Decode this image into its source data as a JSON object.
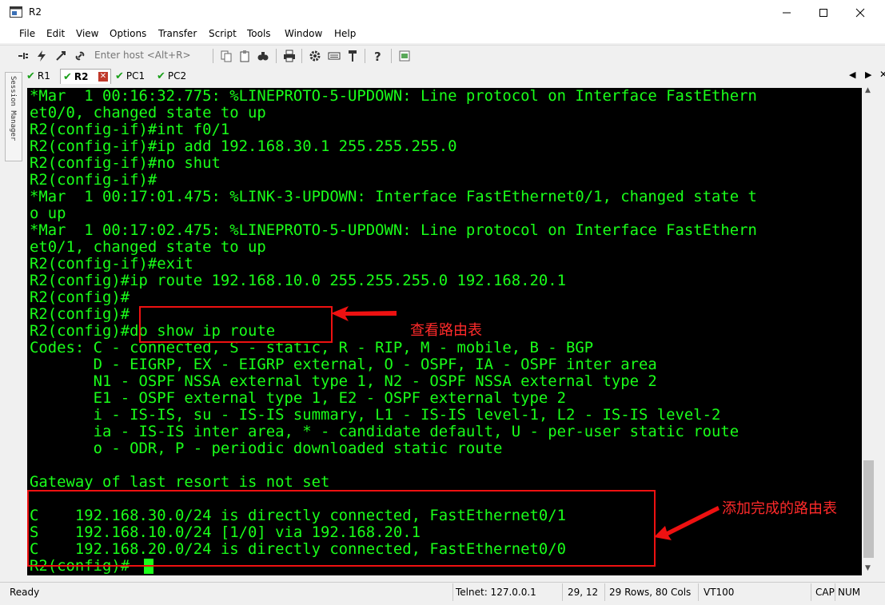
{
  "window": {
    "title": "R2"
  },
  "menu": [
    "File",
    "Edit",
    "View",
    "Options",
    "Transfer",
    "Script",
    "Tools",
    "Window",
    "Help"
  ],
  "toolbar": {
    "host_placeholder": "Enter host <Alt+R>"
  },
  "tabs": [
    {
      "label": "R1",
      "active": false
    },
    {
      "label": "R2",
      "active": true
    },
    {
      "label": "PC1",
      "active": false
    },
    {
      "label": "PC2",
      "active": false
    }
  ],
  "session_manager_label": "Session Manager",
  "terminal": {
    "lines": [
      "*Mar  1 00:16:32.775: %LINEPROTO-5-UPDOWN: Line protocol on Interface FastEthern",
      "et0/0, changed state to up",
      "R2(config-if)#int f0/1",
      "R2(config-if)#ip add 192.168.30.1 255.255.255.0",
      "R2(config-if)#no shut",
      "R2(config-if)#",
      "*Mar  1 00:17:01.475: %LINK-3-UPDOWN: Interface FastEthernet0/1, changed state t",
      "o up",
      "*Mar  1 00:17:02.475: %LINEPROTO-5-UPDOWN: Line protocol on Interface FastEthern",
      "et0/1, changed state to up",
      "R2(config-if)#exit",
      "R2(config)#ip route 192.168.10.0 255.255.255.0 192.168.20.1",
      "R2(config)#",
      "R2(config)#",
      "R2(config)#do show ip route",
      "Codes: C - connected, S - static, R - RIP, M - mobile, B - BGP",
      "       D - EIGRP, EX - EIGRP external, O - OSPF, IA - OSPF inter area",
      "       N1 - OSPF NSSA external type 1, N2 - OSPF NSSA external type 2",
      "       E1 - OSPF external type 1, E2 - OSPF external type 2",
      "       i - IS-IS, su - IS-IS summary, L1 - IS-IS level-1, L2 - IS-IS level-2",
      "       ia - IS-IS inter area, * - candidate default, U - per-user static route",
      "       o - ODR, P - periodic downloaded static route",
      "",
      "Gateway of last resort is not set",
      "",
      "C    192.168.30.0/24 is directly connected, FastEthernet0/1",
      "S    192.168.10.0/24 [1/0] via 192.168.20.1",
      "C    192.168.20.0/24 is directly connected, FastEthernet0/0",
      "R2(config)#"
    ]
  },
  "annotations": {
    "show_route_note": "查看路由表",
    "done_route_note": "添加完成的路由表"
  },
  "status": {
    "ready": "Ready",
    "connection": "Telnet: 127.0.0.1",
    "cursor_pos": "29,  12",
    "size": "29 Rows, 80 Cols",
    "emulation": "VT100",
    "caps": "CAP",
    "num": "NUM"
  },
  "colors": {
    "terminal_bg": "#000000",
    "terminal_fg": "#1aff1a",
    "annotation": "#ee1111",
    "tab_check": "#1a9f1a"
  }
}
